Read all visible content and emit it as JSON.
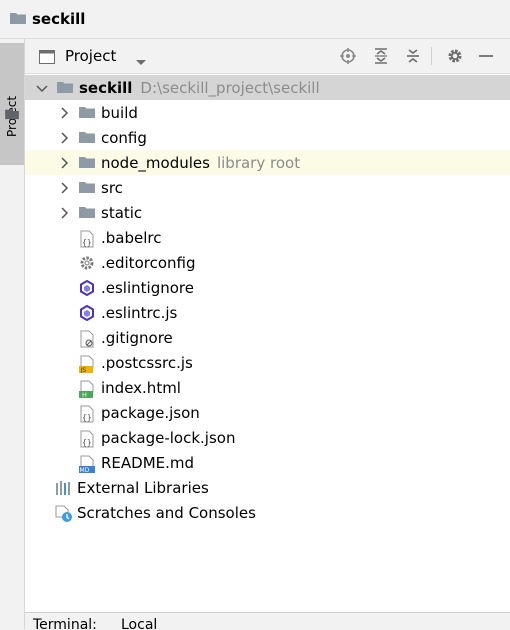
{
  "breadcrumb": {
    "label": "seckill",
    "icon": "folder-icon"
  },
  "tool_strip": {
    "project_tab": "Project"
  },
  "panel": {
    "title": "Project",
    "icons": [
      "locate-icon",
      "expand-all-icon",
      "collapse-all-icon",
      "gear-icon",
      "minimize-icon"
    ]
  },
  "tree": {
    "root": {
      "name": "seckill",
      "path": "D:\\seckill_project\\seckill"
    },
    "folders": [
      {
        "name": "build"
      },
      {
        "name": "config"
      },
      {
        "name": "node_modules",
        "hint": "library root"
      },
      {
        "name": "src"
      },
      {
        "name": "static"
      }
    ],
    "files": [
      {
        "name": ".babelrc",
        "icon": "json-file-icon"
      },
      {
        "name": ".editorconfig",
        "icon": "gear-file-icon"
      },
      {
        "name": ".eslintignore",
        "icon": "eslint-icon"
      },
      {
        "name": ".eslintrc.js",
        "icon": "eslint-icon"
      },
      {
        "name": ".gitignore",
        "icon": "ignore-file-icon"
      },
      {
        "name": ".postcssrc.js",
        "icon": "js-file-icon"
      },
      {
        "name": "index.html",
        "icon": "html-file-icon"
      },
      {
        "name": "package.json",
        "icon": "json-file-icon"
      },
      {
        "name": "package-lock.json",
        "icon": "json-file-icon"
      },
      {
        "name": "README.md",
        "icon": "md-file-icon"
      }
    ],
    "external": {
      "name": "External Libraries"
    },
    "scratches": {
      "name": "Scratches and Consoles"
    }
  },
  "bottom": {
    "tab1": "Terminal:",
    "tab2": "Local"
  },
  "colors": {
    "selected_row": "#d5d5d5",
    "highlight_row": "#fbfbe6",
    "folder": "#8e9aa6",
    "hint": "#8c8c8c",
    "eslint": "#4b32c3"
  }
}
